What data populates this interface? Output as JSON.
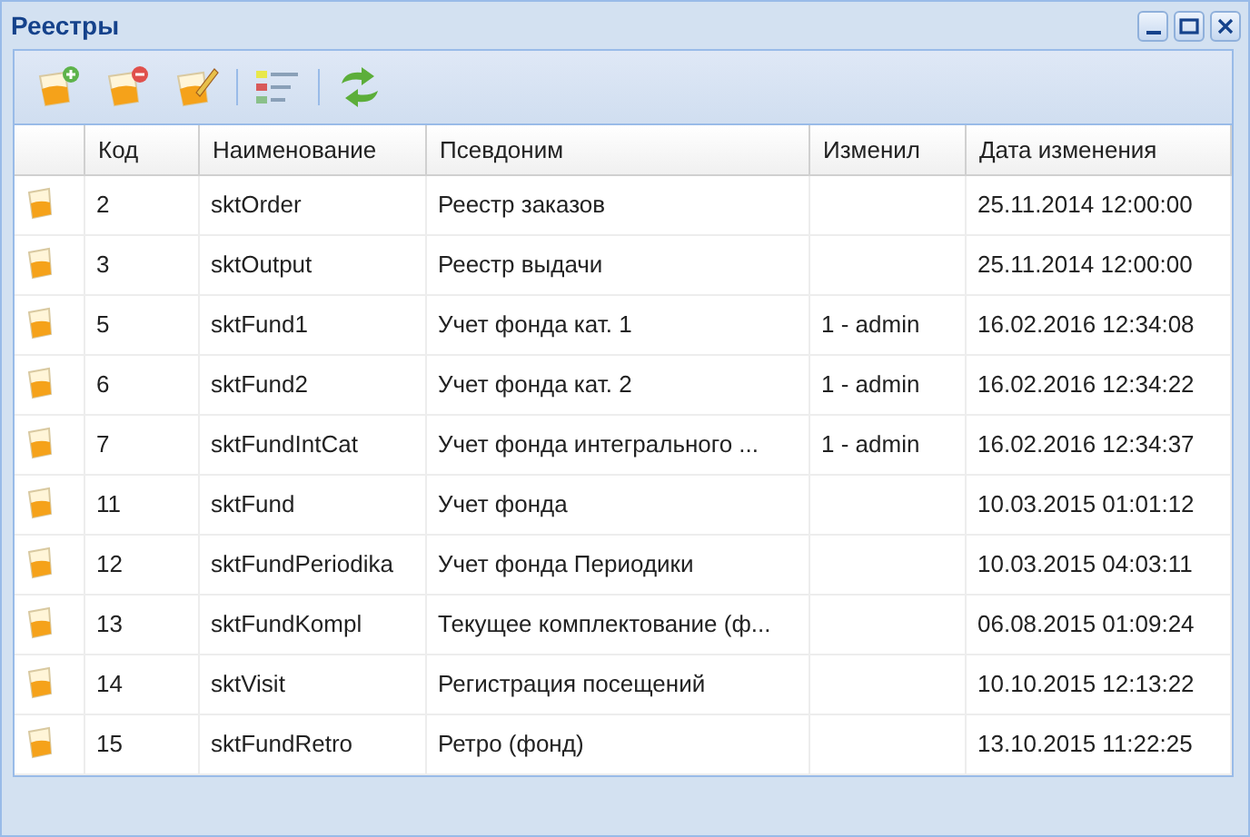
{
  "window": {
    "title": "Реестры"
  },
  "table": {
    "columns": [
      "Код",
      "Наименование",
      "Псевдоним",
      "Изменил",
      "Дата изменения"
    ],
    "rows": [
      {
        "cells": [
          "2",
          "sktOrder",
          "Реестр заказов",
          "",
          "25.11.2014 12:00:00"
        ]
      },
      {
        "cells": [
          "3",
          "sktOutput",
          "Реестр выдачи",
          "",
          "25.11.2014 12:00:00"
        ]
      },
      {
        "cells": [
          "5",
          "sktFund1",
          "Учет фонда кат. 1",
          "1 - admin",
          "16.02.2016 12:34:08"
        ]
      },
      {
        "cells": [
          "6",
          "sktFund2",
          "Учет фонда кат. 2",
          "1 - admin",
          "16.02.2016 12:34:22"
        ]
      },
      {
        "cells": [
          "7",
          "sktFundIntCat",
          "Учет фонда интегрального ...",
          "1 - admin",
          "16.02.2016 12:34:37"
        ]
      },
      {
        "cells": [
          "11",
          "sktFund",
          "Учет фонда",
          "",
          "10.03.2015 01:01:12"
        ]
      },
      {
        "cells": [
          "12",
          "sktFundPeriodika",
          "Учет фонда Периодики",
          "",
          "10.03.2015 04:03:11"
        ]
      },
      {
        "cells": [
          "13",
          "sktFundKompl",
          "Текущее комплектование (ф...",
          "",
          "06.08.2015 01:09:24"
        ]
      },
      {
        "cells": [
          "14",
          "sktVisit",
          "Регистрация посещений",
          "",
          "10.10.2015 12:13:22"
        ]
      },
      {
        "cells": [
          "15",
          "sktFundRetro",
          "Ретро (фонд)",
          "",
          "13.10.2015 11:22:25"
        ]
      }
    ]
  }
}
